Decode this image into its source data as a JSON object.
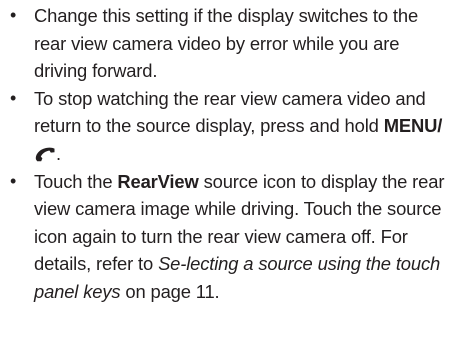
{
  "bullets": {
    "b1": {
      "mark": "•",
      "text": "Change this setting if the display switches to the rear view camera video by error while you are driving forward."
    },
    "b2": {
      "mark": "•",
      "text_before": "To stop watching the rear view camera video and return to the source display, press and hold ",
      "key_label": "MENU/",
      "icon": "phone-handset-icon",
      "text_after": "."
    },
    "b3": {
      "mark": "•",
      "text_1": "Touch the ",
      "source_name": "RearView",
      "text_2": " source icon to display the rear view camera image while driving. Touch the source icon again to turn the rear view camera off. For details, refer to ",
      "reference_title": "Se-lecting a source using the touch panel keys",
      "text_3": " on page 11."
    }
  }
}
